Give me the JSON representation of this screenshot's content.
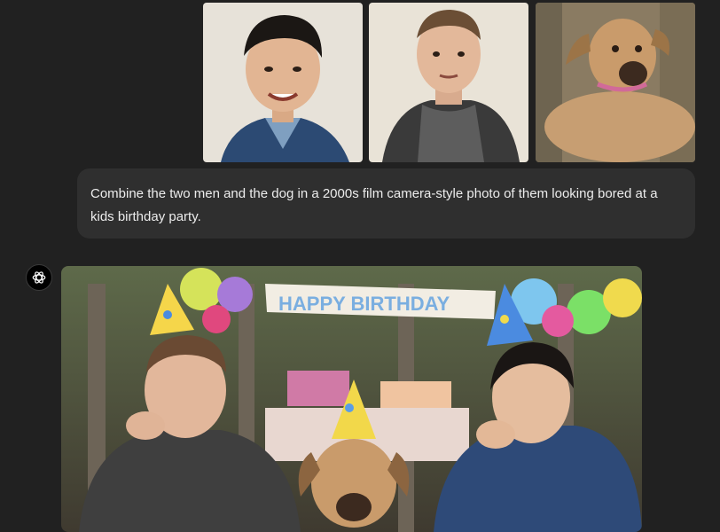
{
  "attachments": [
    {
      "name": "man-1-photo"
    },
    {
      "name": "man-2-photo"
    },
    {
      "name": "dog-photo"
    }
  ],
  "user_message": {
    "text": "Combine the two men and the dog in a 2000s film camera-style photo of them looking bored at a kids birthday party."
  },
  "assistant": {
    "avatar_icon": "openai-logo-icon",
    "image_banner_text": "HAPPY BIRTHDAY"
  },
  "colors": {
    "background": "#212121",
    "bubble": "#2f2f2f",
    "text": "#ececec"
  }
}
